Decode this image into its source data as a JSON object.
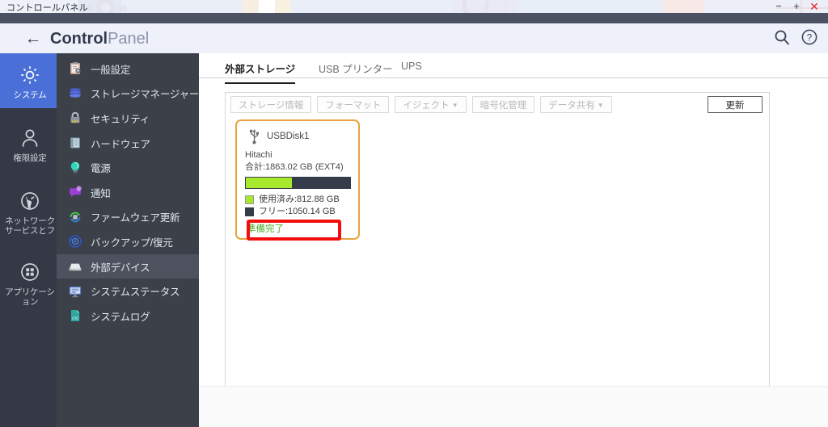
{
  "desktop": {
    "taskbar_label": "コントロールパネル"
  },
  "window": {
    "controls": [
      {
        "name": "minimize",
        "glyph": "−"
      },
      {
        "name": "maximize",
        "glyph": "+"
      },
      {
        "name": "close",
        "glyph": "✕"
      }
    ]
  },
  "header": {
    "back_icon": "←",
    "title_bold": "Control",
    "title_light": "Panel",
    "icons": [
      {
        "name": "search-icon"
      },
      {
        "name": "help-icon"
      }
    ]
  },
  "rail": {
    "items": [
      {
        "label": "システム",
        "icon": "gear-icon",
        "active": true
      },
      {
        "label": "権限設定",
        "icon": "user-icon",
        "active": false
      },
      {
        "label": "ネットワーク\nサービスとフ",
        "icon": "globe-icon",
        "active": false
      },
      {
        "label": "アプリケーション",
        "icon": "grid-icon",
        "active": false
      }
    ]
  },
  "nav": {
    "items": [
      {
        "label": "一般設定",
        "icon": "clipboard-icon",
        "active": false
      },
      {
        "label": "ストレージマネージャー",
        "icon": "database-icon",
        "active": false
      },
      {
        "label": "セキュリティ",
        "icon": "lock-icon",
        "active": false
      },
      {
        "label": "ハードウェア",
        "icon": "hardware-icon",
        "active": false
      },
      {
        "label": "電源",
        "icon": "bulb-icon",
        "active": false
      },
      {
        "label": "通知",
        "icon": "notification-icon",
        "active": false
      },
      {
        "label": "ファームウェア更新",
        "icon": "firmware-update-icon",
        "active": false
      },
      {
        "label": "バックアップ/復元",
        "icon": "backup-restore-icon",
        "active": false
      },
      {
        "label": "外部デバイス",
        "icon": "external-device-icon",
        "active": true
      },
      {
        "label": "システムステータス",
        "icon": "monitor-icon",
        "active": false
      },
      {
        "label": "システムログ",
        "icon": "log-icon",
        "active": false
      }
    ]
  },
  "main": {
    "tabs": [
      {
        "label": "外部ストレージ",
        "active": true
      },
      {
        "label": "USB プリンター",
        "active": false
      },
      {
        "label": "UPS",
        "active": false
      }
    ],
    "toolbar": {
      "buttons": [
        {
          "label": "ストレージ情報",
          "enabled": false,
          "caret": false
        },
        {
          "label": "フォーマット",
          "enabled": false,
          "caret": false
        },
        {
          "label": "イジェクト",
          "enabled": false,
          "caret": true
        },
        {
          "label": "暗号化管理",
          "enabled": false,
          "caret": false
        },
        {
          "label": "データ共有",
          "enabled": false,
          "caret": true
        }
      ],
      "refresh": {
        "label": "更新",
        "enabled": true
      }
    },
    "device_card": {
      "icon": "usb-icon",
      "name": "USBDisk1",
      "vendor": "Hitachi",
      "capacity_line": "合計:1863.02 GB (EXT4)",
      "usage_percent": 44,
      "legend": [
        {
          "label": "使用済み:812.88 GB",
          "color": "#a8e82c"
        },
        {
          "label": "フリー:1050.14 GB",
          "color": "#343c49"
        }
      ],
      "status": "準備完了",
      "status_color": "#4cae2b",
      "border_color": "#e8a33f"
    },
    "annotation": {
      "name": "red-highlight-box",
      "color": "#f40d0d"
    }
  }
}
